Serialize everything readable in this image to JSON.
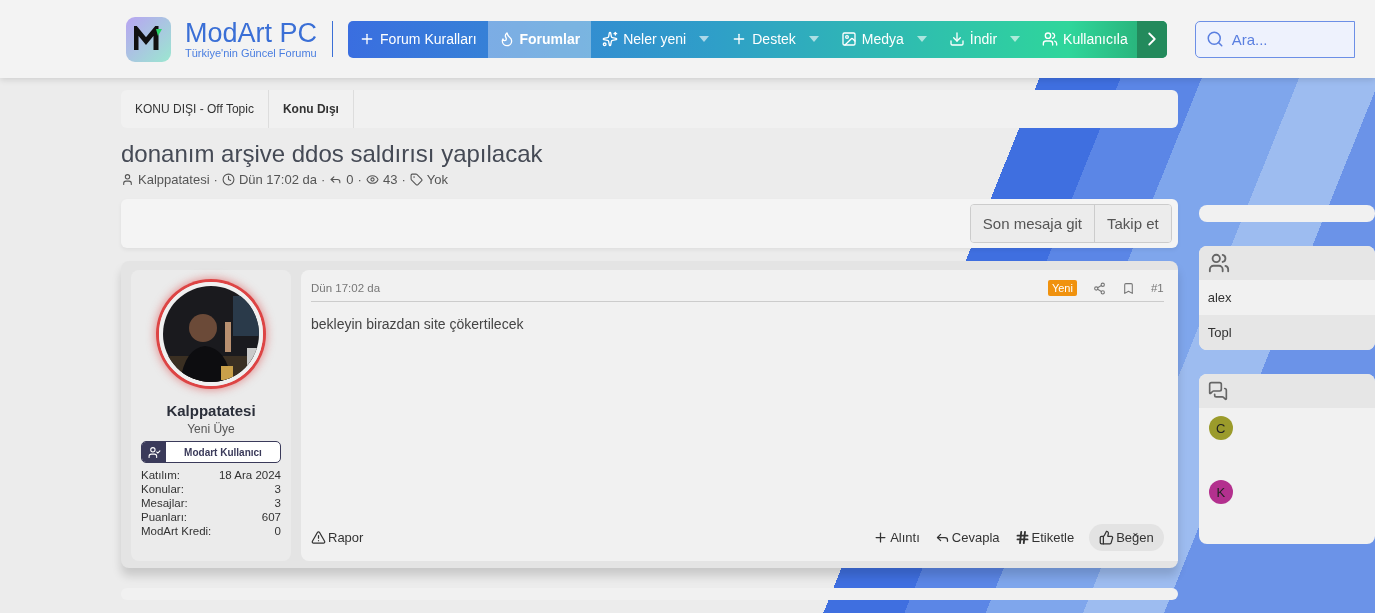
{
  "header": {
    "logo_title": "ModArt PC",
    "logo_subtitle": "Türkiye'nin Güncel Forumu"
  },
  "nav": [
    {
      "label": "Forum Kuralları",
      "selected": false,
      "has_menu": false
    },
    {
      "label": "Forumlar",
      "selected": true,
      "has_menu": false
    },
    {
      "label": "Neler yeni",
      "selected": false,
      "has_menu": true
    },
    {
      "label": "Destek",
      "selected": false,
      "has_menu": true
    },
    {
      "label": "Medya",
      "selected": false,
      "has_menu": true
    },
    {
      "label": "İndir",
      "selected": false,
      "has_menu": true
    },
    {
      "label": "Kullanıcıla",
      "selected": false,
      "has_menu": false
    }
  ],
  "search": {
    "placeholder": "Ara..."
  },
  "breadcrumbs": [
    {
      "label": "KONU DIŞI - Off Topic",
      "selected": false
    },
    {
      "label": "Konu Dışı",
      "selected": true
    }
  ],
  "thread": {
    "title": "donanım arşive ddos saldırısı yapılacak",
    "separator": "·",
    "meta": [
      "Kalppatatesi",
      "Dün 17:02 da",
      "0",
      "43",
      "Yok"
    ]
  },
  "thread_buttons": [
    "Son mesaja git",
    "Takip et"
  ],
  "post": {
    "author": "Kalppatatesi",
    "role": "Yeni Üye",
    "banner": "Modart Kullanıcı",
    "stats": [
      {
        "label": "Katılım:",
        "value": "18 Ara 2024"
      },
      {
        "label": "Konular:",
        "value": "3"
      },
      {
        "label": "Mesajlar:",
        "value": "3"
      },
      {
        "label": "Puanları:",
        "value": "607"
      },
      {
        "label": "ModArt Kredi:",
        "value": "0"
      }
    ],
    "time": "Dün 17:02 da",
    "badge": "Yeni",
    "number": "#1",
    "body": "bekleyin birazdan site çökertilecek",
    "report": "Rapor",
    "actions": [
      {
        "label": "Alıntı",
        "selected": false
      },
      {
        "label": "Cevapla",
        "selected": false
      },
      {
        "label": "Etiketle",
        "selected": false
      },
      {
        "label": "Beğen",
        "selected": true
      }
    ]
  },
  "sidebar": {
    "members": [
      "alex",
      "Topl"
    ],
    "posts": [
      {
        "letter": "C",
        "color": "#9b9b2b"
      },
      {
        "letter": "K",
        "color": "#b3308e"
      }
    ]
  }
}
